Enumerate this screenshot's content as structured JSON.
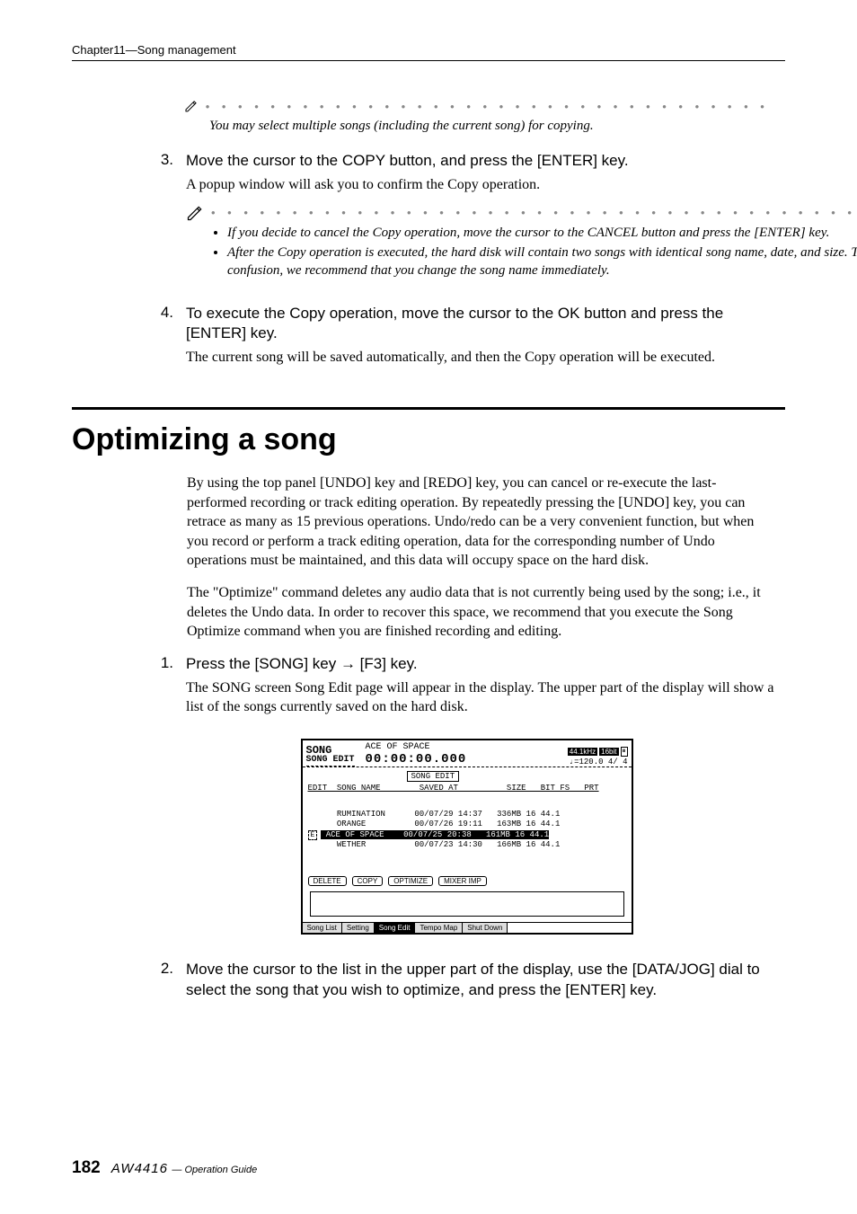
{
  "header": {
    "chapter": "Chapter11—Song management"
  },
  "tip1": {
    "dots": "• • • • • • • • • • • • • • • • • • • • • • • • • • • • • • • • • • • • • • • • • • • • •",
    "text": "You may select multiple songs (including the current song) for copying."
  },
  "step3": {
    "num": "3.",
    "head": "Move the cursor to the COPY button, and press the [ENTER] key.",
    "para": "A popup window will ask you to confirm the Copy operation."
  },
  "tip2": {
    "dots": "• • • • • • • • • • • • • • • • • • • • • • • • • • • • • • • • • • • • • • • • • • • • •",
    "bullets": [
      "If you decide to cancel the Copy operation, move the cursor to the CANCEL button and press the [ENTER] key.",
      "After the Copy operation is executed, the hard disk will contain two songs with identical song name, date, and size. To avoid confusion, we recommend that you change the song name immediately."
    ]
  },
  "step4": {
    "num": "4.",
    "head": "To execute the Copy operation, move the cursor to the OK button and press the [ENTER] key.",
    "para": "The current song will be saved automatically, and then the Copy operation will be executed."
  },
  "section": {
    "title": "Optimizing a song"
  },
  "para1": "By using the top panel [UNDO] key and [REDO] key, you can cancel or re-execute the last-performed recording or track editing operation. By repeatedly pressing the [UNDO] key, you can retrace as many as 15 previous operations. Undo/redo can be a very convenient function, but when you record or perform a track editing operation, data for the corresponding number of Undo operations must be maintained, and this data will occupy space on the hard disk.",
  "para2": "The \"Optimize\" command deletes any audio data that is not currently being used by the song; i.e., it deletes the Undo data. In order to recover this space, we recommend that you execute the Song Optimize command when you are finished recording and editing.",
  "step1": {
    "num": "1.",
    "head_a": "Press the [SONG] key ",
    "head_arrow": "→",
    "head_b": " [F3] key.",
    "para": "The SONG screen Song Edit page will appear in the display. The upper part of the display will show a list of the songs currently saved on the hard disk."
  },
  "screenshot": {
    "song": "SONG",
    "songedit": "SONG EDIT",
    "title": "ACE OF SPACE",
    "time": "00:00:00.000",
    "badge1": "44.1kHz",
    "badge2": "16bit",
    "tempo": "♩=120.0   4/ 4",
    "label": "SONG EDIT",
    "cols": "EDIT  SONG NAME        SAVED AT          SIZE   BIT FS   PRT",
    "rows": [
      "      RUMINATION      00/07/29 14:37   336MB 16 44.1",
      "      ORANGE          00/07/26 19:11   163MB 16 44.1"
    ],
    "row_sel_marker": "E",
    "row_sel": " ACE OF SPACE    00/07/25 20:38   161MB 16 44.1",
    "row_after": "      WETHER          00/07/23 14:30   166MB 16 44.1",
    "btns": [
      "DELETE",
      "COPY",
      "OPTIMIZE",
      "MIXER IMP"
    ],
    "tabs": [
      "Song List",
      "Setting",
      "Song Edit",
      "Tempo Map",
      "Shut Down"
    ]
  },
  "step2": {
    "num": "2.",
    "head": "Move the cursor to the list in the upper part of the display, use the [DATA/JOG] dial to select the song that you wish to optimize, and press the [ENTER] key."
  },
  "footer": {
    "page": "182",
    "model": "AW4416",
    "guide": "— Operation Guide"
  }
}
